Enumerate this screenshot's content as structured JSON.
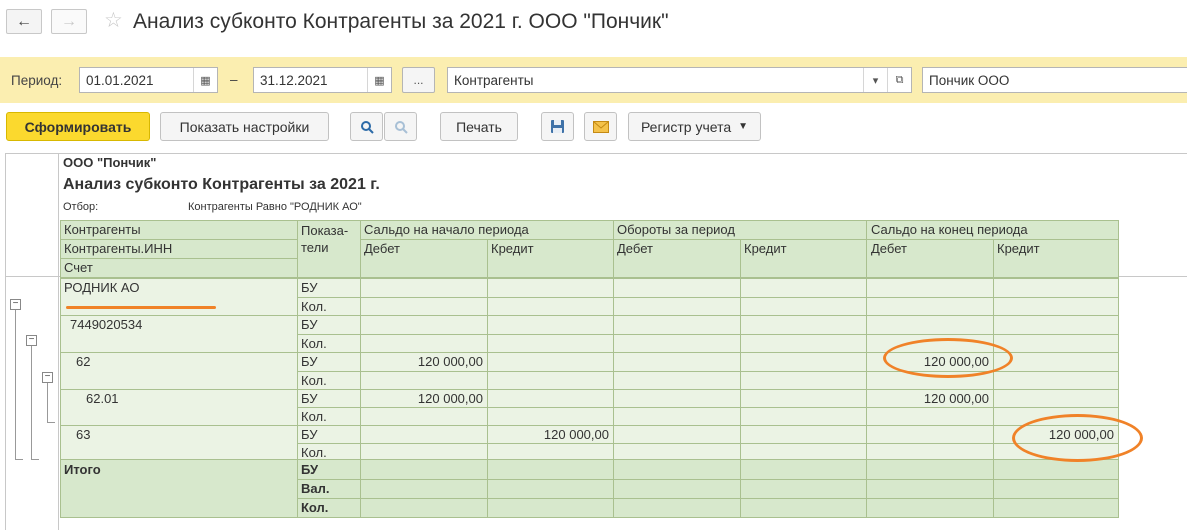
{
  "window": {
    "back_icon": "arrow-left-icon",
    "forward_icon": "arrow-right-icon",
    "favorite_icon": "star-icon",
    "title": "Анализ субконто Контрагенты за 2021 г. ООО \"Пончик\""
  },
  "period_panel": {
    "period_label": "Период:",
    "date_from": "01.01.2021",
    "dash": "–",
    "date_to": "31.12.2021",
    "period_select_label": "...",
    "subconto_type": "Контрагенты",
    "organization": "Пончик ООО"
  },
  "toolbar": {
    "generate_label": "Сформировать",
    "show_settings_label": "Показать настройки",
    "print_label": "Печать",
    "register_label": "Регистр учета"
  },
  "report": {
    "org_name": "ООО \"Пончик\"",
    "heading": "Анализ субконто Контрагенты за 2021 г.",
    "filter_label": "Отбор:",
    "filter_value": "Контрагенты Равно \"РОДНИК АО\"",
    "header": {
      "col1_line1": "Контрагенты",
      "col1_line2": "Контрагенты.ИНН",
      "col1_line3": "Счет",
      "indicators": "Показа-\nтели",
      "opening_balance": "Сальдо на начало периода",
      "turnover": "Обороты за период",
      "closing_balance": "Сальдо на конец периода",
      "debit": "Дебет",
      "credit": "Кредит"
    },
    "rows": [
      {
        "name": "РОДНИК АО",
        "ind": "БУ",
        "ob_d": "",
        "ob_c": "",
        "tr_d": "",
        "tr_c": "",
        "cb_d": "",
        "cb_c": ""
      },
      {
        "name": "",
        "ind": "Кол.",
        "ob_d": "",
        "ob_c": "",
        "tr_d": "",
        "tr_c": "",
        "cb_d": "",
        "cb_c": ""
      },
      {
        "name": "7449020534",
        "ind": "БУ",
        "ob_d": "",
        "ob_c": "",
        "tr_d": "",
        "tr_c": "",
        "cb_d": "",
        "cb_c": ""
      },
      {
        "name": "",
        "ind": "Кол.",
        "ob_d": "",
        "ob_c": "",
        "tr_d": "",
        "tr_c": "",
        "cb_d": "",
        "cb_c": ""
      },
      {
        "name": "62",
        "ind": "БУ",
        "ob_d": "120 000,00",
        "ob_c": "",
        "tr_d": "",
        "tr_c": "",
        "cb_d": "120 000,00",
        "cb_c": ""
      },
      {
        "name": "",
        "ind": "Кол.",
        "ob_d": "",
        "ob_c": "",
        "tr_d": "",
        "tr_c": "",
        "cb_d": "",
        "cb_c": ""
      },
      {
        "name": "62.01",
        "ind": "БУ",
        "ob_d": "120 000,00",
        "ob_c": "",
        "tr_d": "",
        "tr_c": "",
        "cb_d": "120 000,00",
        "cb_c": ""
      },
      {
        "name": "",
        "ind": "Кол.",
        "ob_d": "",
        "ob_c": "",
        "tr_d": "",
        "tr_c": "",
        "cb_d": "",
        "cb_c": ""
      },
      {
        "name": "63",
        "ind": "БУ",
        "ob_d": "",
        "ob_c": "120 000,00",
        "tr_d": "",
        "tr_c": "",
        "cb_d": "",
        "cb_c": "120 000,00"
      },
      {
        "name": "",
        "ind": "Кол.",
        "ob_d": "",
        "ob_c": "",
        "tr_d": "",
        "tr_c": "",
        "cb_d": "",
        "cb_c": ""
      }
    ],
    "total": {
      "label": "Итого",
      "ind1": "БУ",
      "ind2": "Вал.",
      "ind3": "Кол."
    }
  },
  "colors": {
    "accent_yellow": "#fbd92e",
    "panel_yellow": "#fbeeb0",
    "header_green": "#d7e8cc",
    "row_green": "#ebf3e4",
    "annotation_orange": "#f08228"
  }
}
